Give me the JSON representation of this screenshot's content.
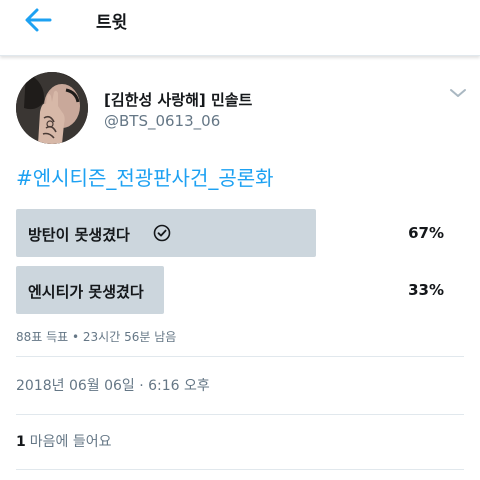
{
  "header": {
    "title": "트윗",
    "back_icon": "arrow-left-icon"
  },
  "tweet": {
    "author": {
      "display_name": "[김한성 사랑해] 민솔트",
      "handle": "@BTS_0613_06",
      "avatar": "avatar-photo"
    },
    "menu_icon": "chevron-down-icon",
    "text": "#엔시티즌_전광판사건_공론화",
    "poll": {
      "options": [
        {
          "label": "방탄이 못생겼다",
          "percent_text": "67%",
          "percent": 67,
          "winner": true
        },
        {
          "label": "엔시티가 못생겼다",
          "percent_text": "33%",
          "percent": 33,
          "winner": false
        }
      ],
      "meta": "88표 득표 • 23시간 56분  남음"
    },
    "timestamp": "2018년 06월 06일 · 6:16 오후",
    "likes": {
      "count": "1",
      "label": "마음에 들어요"
    }
  },
  "colors": {
    "accent": "#1da1f2",
    "poll_fill": "#ccd6dd",
    "secondary_text": "#657786"
  }
}
